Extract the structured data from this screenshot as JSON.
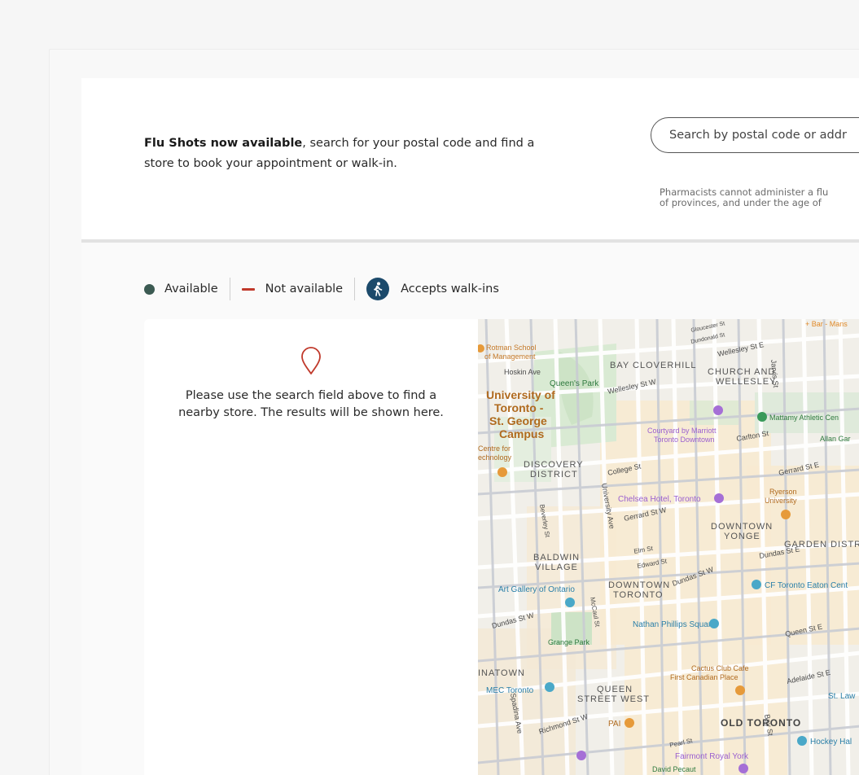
{
  "intro": {
    "bold": "Flu Shots now available",
    "rest": ", search for your postal code and find a store to book your appointment or walk-in."
  },
  "search": {
    "placeholder": "Search by postal code or addr"
  },
  "disclaimer": {
    "line1": "Pharmacists cannot administer a flu",
    "line2": "of provinces, and under the age of"
  },
  "legend": {
    "available": "Available",
    "not_available": "Not available",
    "walkins": "Accepts walk-ins"
  },
  "colors": {
    "available_dot": "#3b5a52",
    "not_available_dash": "#c0392b",
    "walkin_badge": "#1c4a6b"
  },
  "results": {
    "message": "Please use the search field above to find a nearby store. The results will be shown here."
  },
  "map": {
    "labels": {
      "rotman": "Rotman School",
      "rotman2": "of Management",
      "hoskin": "Hoskin Ave",
      "queens_park": "Queen's Park",
      "bay_cloverhill": "BAY CLOVERHILL",
      "church": "CHURCH AND",
      "wellesley": "WELLESLEY",
      "wellesley_st_w": "Wellesley St W",
      "wellesley_st_e": "Wellesley St E",
      "jarvis": "Jarvis St",
      "uoft1": "University of",
      "uoft2": "Toronto -",
      "uoft3": "St. George",
      "uoft4": "Campus",
      "courtyard1": "Courtyard by Marriott",
      "courtyard2": "Toronto Downtown",
      "carlton": "Carlton St",
      "mattamy": "Mattamy Athletic Cen",
      "allan": "Allan Gar",
      "centre1": "Centre for",
      "centre2": "echnology",
      "discovery1": "DISCOVERY",
      "discovery2": "DISTRICT",
      "college": "College St",
      "gerrard_e": "Gerrard St E",
      "ryerson1": "Ryerson",
      "ryerson2": "University",
      "chelsea": "Chelsea Hotel, Toronto",
      "gerrard_w": "Gerrard St W",
      "downtown_yonge1": "DOWNTOWN",
      "downtown_yonge2": "YONGE",
      "garden": "GARDEN DISTR",
      "baldwin1": "BALDWIN",
      "baldwin2": "VILLAGE",
      "elm": "Elm St",
      "edward": "Edward St",
      "dundas_e": "Dundas St E",
      "dundas_w": "Dundas St W",
      "downtown_toronto1": "DOWNTOWN",
      "downtown_toronto2": "TORONTO",
      "ago": "Art Gallery of Ontario",
      "eaton": "CF Toronto Eaton Cent",
      "dundas_w2": "Dundas St W",
      "nathan": "Nathan Phillips Square",
      "queen_e": "Queen St E",
      "grange": "Grange Park",
      "cactus1": "Cactus Club Cafe",
      "cactus2": "First Canadian Place",
      "adelaide": "Adelaide St E",
      "inatown": "INATOWN",
      "queen_west1": "QUEEN",
      "queen_west2": "STREET WEST",
      "mec": "MEC Toronto",
      "st_law": "St. Law",
      "richmond": "Richmond St W",
      "old_toronto": "OLD TORONTO",
      "pai": "PAI",
      "pearl": "Pearl St",
      "hockey": "Hockey Hal",
      "fairmont": "Fairmont Royal York",
      "pecaut": "David Pecaut",
      "bar": "+ Bar - Mans",
      "gloucester": "Gloucester St",
      "dundonald": "Dundonald St",
      "university_ave": "University Ave",
      "spadina": "Spadina Ave",
      "bay_st": "Bay St",
      "mccaul": "McCaul St",
      "beverley": "Beverley St"
    }
  }
}
